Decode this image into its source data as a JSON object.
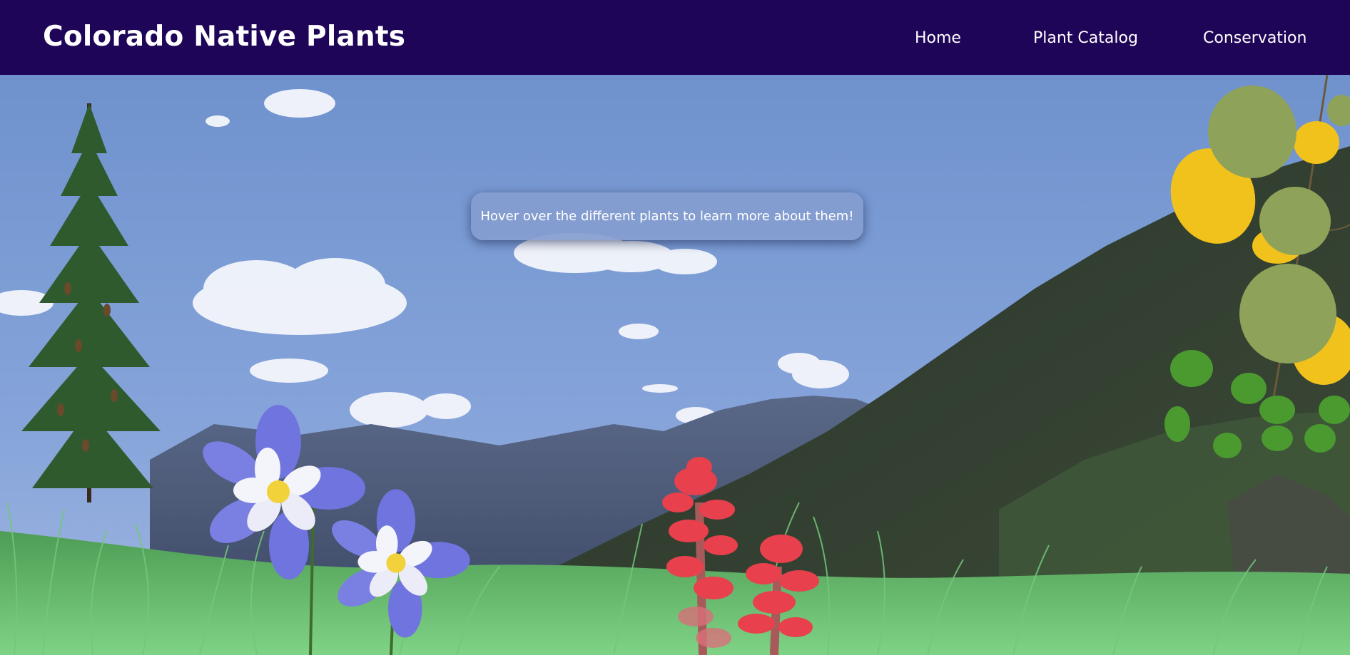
{
  "header": {
    "site_title": "Colorado Native Plants",
    "nav": [
      {
        "label": "Home"
      },
      {
        "label": "Plant Catalog"
      },
      {
        "label": "Conservation"
      }
    ]
  },
  "hint": {
    "text": "Hover over the different plants to learn more about them!"
  },
  "colors": {
    "header_bg": "#1e0557",
    "sky": "#7f9ed4",
    "mountain": "#4a5876",
    "forest": "#2d3a30",
    "grass": "#5fb867",
    "columbine_petal": "#7b7fe0",
    "paintbrush": "#e8404c",
    "aspen_yellow": "#f2c21c",
    "aspen_green": "#8fa25a",
    "spruce": "#2f5a2e"
  },
  "plants": [
    {
      "icon": "spruce-tree-icon"
    },
    {
      "icon": "columbine-flower-icon"
    },
    {
      "icon": "paintbrush-flower-icon"
    },
    {
      "icon": "aspen-leaves-icon"
    }
  ]
}
